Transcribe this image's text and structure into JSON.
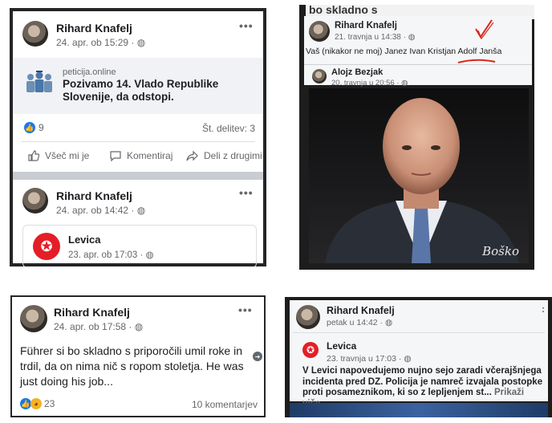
{
  "panel1": {
    "post1": {
      "author": "Rihard Knafelj",
      "timestamp": "24. apr. ob 15:29 · ",
      "link_domain": "peticija.online",
      "link_title": "Pozivamo 14. Vlado Republike Slovenije, da odstopi.",
      "like_count": "9",
      "shares": "Št. delitev: 3",
      "actions": {
        "like": "Všeč mi je",
        "comment": "Komentiraj",
        "share": "Deli z drugimi"
      }
    },
    "post2": {
      "author": "Rihard Knafelj",
      "timestamp": "24. apr. ob 14:42 · ",
      "shared_page": "Levica",
      "shared_timestamp": "23. apr. ob 17:03 · "
    }
  },
  "panel2": {
    "post": {
      "author": "Rihard Knafelj",
      "timestamp": "21. travnja u 14:38 · ",
      "text": "Vaš (nikakor ne moj) Janez Ivan Kristjan Adolf Janša"
    },
    "comment": {
      "author": "Alojz Bezjak",
      "timestamp": "20. travnja u 20:56 · "
    },
    "watermark": "Boško",
    "top_text": "bo skladno s"
  },
  "panel3": {
    "author": "Rihard Knafelj",
    "timestamp": "24. apr. ob 17:58 · ",
    "text": "Führer si bo skladno s priporočili umil roke in trdil, da on nima nič s ropom stoletja. He was just doing his job...",
    "reaction_count": "23",
    "comments": "10 komentarjev"
  },
  "panel4": {
    "author": "Rihard Knafelj",
    "timestamp": "petak u 14:42 · ",
    "shared_page": "Levica",
    "shared_timestamp": "23. travnja u 17:03 · ",
    "text": "V Levici napovedujemo nujno sejo zaradi včerajšnjega incidenta pred DZ. Policija je namreč izvajala postopke proti posameznikom, ki so z lepljenjem st... ",
    "see_more": "Prikaži više"
  },
  "colors": {
    "facebook_blue": "#1877f2",
    "levica_red": "#e41e26",
    "meta_grey": "#65676b"
  }
}
